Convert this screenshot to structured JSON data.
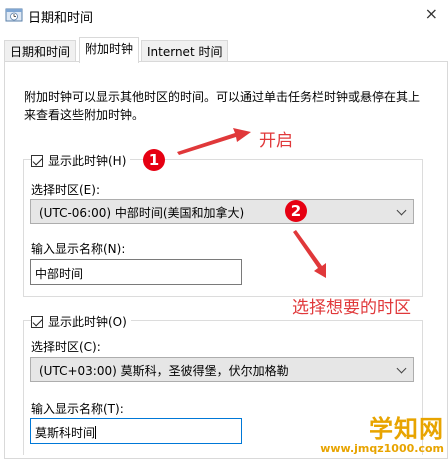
{
  "window": {
    "title": "日期和时间"
  },
  "tabs": [
    {
      "label": "日期和时间",
      "active": false
    },
    {
      "label": "附加时钟",
      "active": true
    },
    {
      "label": "Internet 时间",
      "active": false
    }
  ],
  "description": "附加时钟可以显示其他时区的时间。可以通过单击任务栏时钟或悬停在其上来查看这些附加时钟。",
  "clock1": {
    "checkbox_label": "显示此时钟(H)",
    "checked": true,
    "timezone_label": "选择时区(E):",
    "timezone_value": "(UTC-06:00) 中部时间(美国和加拿大)",
    "name_label": "输入显示名称(N):",
    "name_value": "中部时间"
  },
  "clock2": {
    "checkbox_label": "显示此时钟(O)",
    "checked": true,
    "timezone_label": "选择时区(C):",
    "timezone_value": "(UTC+03:00) 莫斯科，圣彼得堡，伏尔加格勒",
    "name_label": "输入显示名称(T):",
    "name_value": "莫斯科时间"
  },
  "annotations": {
    "badge1": "1",
    "badge2": "2",
    "enable_text": "开启",
    "choose_text": "选择想要的时区",
    "color": "#e0383a"
  },
  "watermark": {
    "main": "学知网",
    "sub": "www.jmqz1000.com",
    "color": "#e8a400"
  }
}
